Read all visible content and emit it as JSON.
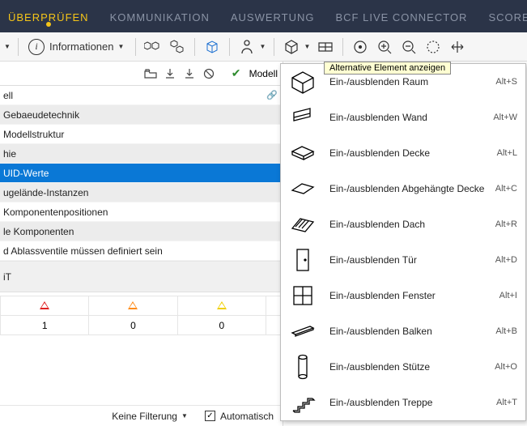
{
  "tabs": {
    "items": [
      "ÜBERPRÜFEN",
      "KOMMUNIKATION",
      "AUSWERTUNG",
      "BCF LIVE CONNECTOR",
      "SCORE"
    ],
    "plus": "+"
  },
  "toolbar": {
    "info_label": "Informationen",
    "modell_label": "Modell"
  },
  "tree": {
    "rows": [
      {
        "label": "ell",
        "grey": false,
        "selected": false,
        "link": true
      },
      {
        "label": "Gebaeudetechnik",
        "grey": true,
        "selected": false
      },
      {
        "label": "Modellstruktur",
        "grey": false,
        "selected": false
      },
      {
        "label": "hie",
        "grey": true,
        "selected": false
      },
      {
        "label": "UID-Werte",
        "grey": false,
        "selected": true
      },
      {
        "label": "ugelände-Instanzen",
        "grey": true,
        "selected": false
      },
      {
        "label": "Komponentenpositionen",
        "grey": false,
        "selected": false
      },
      {
        "label": "le Komponenten",
        "grey": true,
        "selected": false
      },
      {
        "label": "d Ablassventile müssen definiert sein",
        "grey": false,
        "selected": false
      }
    ],
    "band_label": "iT"
  },
  "results": {
    "row1": [
      "1",
      "0",
      "0"
    ]
  },
  "bottom": {
    "filter_label": "Keine Filterung",
    "auto_label": "Automatisch"
  },
  "popup": {
    "tooltip": "Alternative Element anzeigen",
    "items": [
      {
        "label": "Ein-/ausblenden Raum",
        "shortcut": "Alt+S"
      },
      {
        "label": "Ein-/ausblenden Wand",
        "shortcut": "Alt+W"
      },
      {
        "label": "Ein-/ausblenden Decke",
        "shortcut": "Alt+L"
      },
      {
        "label": "Ein-/ausblenden Abgehängte Decke",
        "shortcut": "Alt+C"
      },
      {
        "label": "Ein-/ausblenden Dach",
        "shortcut": "Alt+R"
      },
      {
        "label": "Ein-/ausblenden Tür",
        "shortcut": "Alt+D"
      },
      {
        "label": "Ein-/ausblenden Fenster",
        "shortcut": "Alt+I"
      },
      {
        "label": "Ein-/ausblenden Balken",
        "shortcut": "Alt+B"
      },
      {
        "label": "Ein-/ausblenden Stütze",
        "shortcut": "Alt+O"
      },
      {
        "label": "Ein-/ausblenden Treppe",
        "shortcut": "Alt+T"
      }
    ]
  }
}
